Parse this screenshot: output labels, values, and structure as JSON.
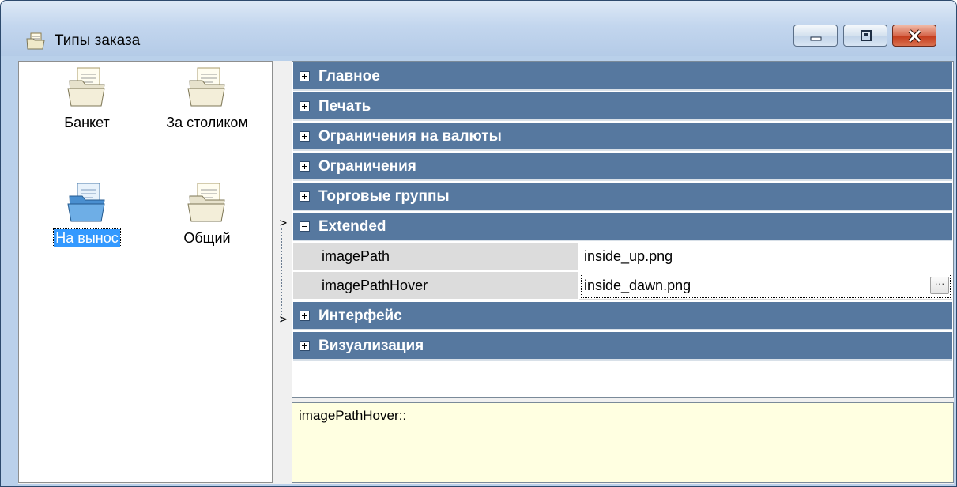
{
  "window": {
    "title": "Типы заказа",
    "icon": "folder-document-icon"
  },
  "left_pane": {
    "items": [
      {
        "label": "Банкет",
        "icon": "folder-icon",
        "selected": false
      },
      {
        "label": "За столиком",
        "icon": "folder-icon",
        "selected": false
      },
      {
        "label": "На вынос",
        "icon": "folder-blue-icon",
        "selected": true
      },
      {
        "label": "Общий",
        "icon": "folder-icon",
        "selected": false
      }
    ]
  },
  "property_grid": {
    "categories": [
      {
        "name": "Главное",
        "expanded": false
      },
      {
        "name": "Печать",
        "expanded": false
      },
      {
        "name": "Ограничения на валюты",
        "expanded": false
      },
      {
        "name": "Ограничения",
        "expanded": false
      },
      {
        "name": "Торговые группы",
        "expanded": false
      },
      {
        "name": "Extended",
        "expanded": true
      },
      {
        "name": "Интерфейс",
        "expanded": false
      },
      {
        "name": "Визуализация",
        "expanded": false
      }
    ],
    "properties": [
      {
        "name": "imagePath",
        "value": "inside_up.png"
      },
      {
        "name": "imagePathHover",
        "value": "inside_dawn.png"
      }
    ],
    "ellipsis_label": "···"
  },
  "description": {
    "text": "imagePathHover::"
  },
  "colors": {
    "category_bg": "#56789f",
    "selection": "#3399ff",
    "description_bg": "#ffffe1"
  }
}
